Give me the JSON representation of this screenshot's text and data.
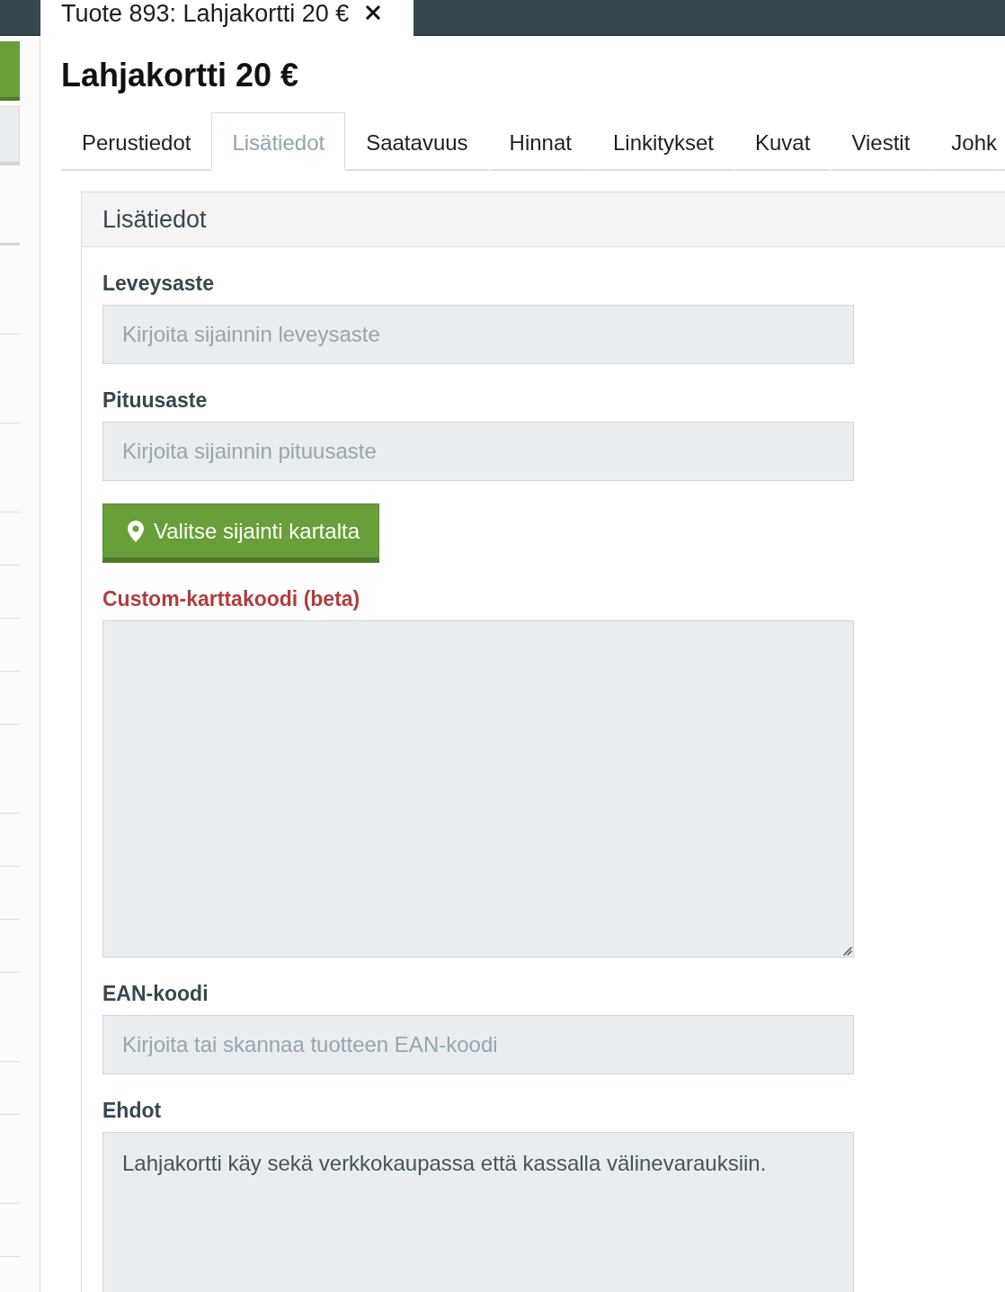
{
  "top_bar": {
    "tab": {
      "title": "Tuote 893: Lahjakortti 20 €",
      "selected": true
    }
  },
  "page_title": "Lahjakortti 20 €",
  "tabs": [
    {
      "label": "Perustiedot",
      "selected": false
    },
    {
      "label": "Lisätiedot",
      "selected": true
    },
    {
      "label": "Saatavuus",
      "selected": false
    },
    {
      "label": "Hinnat",
      "selected": false
    },
    {
      "label": "Linkitykset",
      "selected": false
    },
    {
      "label": "Kuvat",
      "selected": false
    },
    {
      "label": "Viestit",
      "selected": false
    },
    {
      "label": "Johk",
      "selected": false
    }
  ],
  "panel": {
    "title": "Lisätiedot",
    "fields": [
      {
        "kind": "input",
        "label": "Leveysaste",
        "highlighted": false,
        "placeholder": "Kirjoita sijainnin leveysaste"
      },
      {
        "kind": "input",
        "label": "Pituusaste",
        "highlighted": false,
        "placeholder": "Kirjoita sijainnin pituusaste"
      },
      {
        "kind": "button",
        "text": "Valitse sijainti kartalta"
      },
      {
        "kind": "textarea",
        "label": "Custom-karttakoodi (beta)",
        "highlighted": true
      },
      {
        "kind": "input",
        "label": "EAN-koodi",
        "highlighted": false,
        "placeholder": "Kirjoita tai skannaa tuotteen EAN-koodi"
      },
      {
        "kind": "textarea",
        "label": "Ehdot",
        "highlighted": false,
        "value": "Lahjakortti käy sekä verkkokaupassa että kassalla välinevarauksiin."
      }
    ]
  }
}
